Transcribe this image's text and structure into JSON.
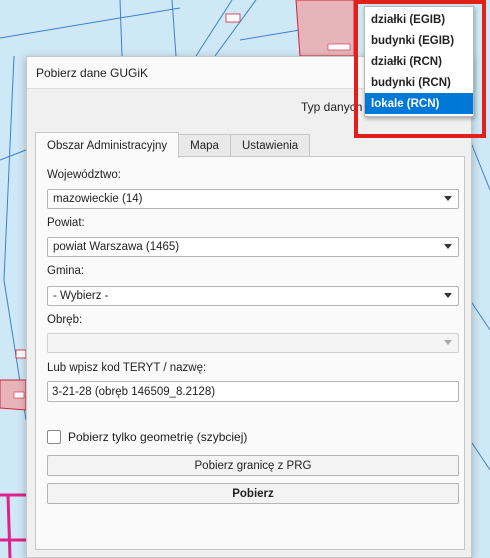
{
  "dialog": {
    "title": "Pobierz dane GUGiK",
    "typ_label": "Typ danych"
  },
  "tabs": [
    {
      "label": "Obszar Administracyjny",
      "active": true
    },
    {
      "label": "Mapa",
      "active": false
    },
    {
      "label": "Ustawienia",
      "active": false
    }
  ],
  "form": {
    "wojewodztwo_label": "Województwo:",
    "wojewodztwo_value": "mazowieckie (14)",
    "powiat_label": "Powiat:",
    "powiat_value": "powiat Warszawa (1465)",
    "gmina_label": "Gmina:",
    "gmina_value": "- Wybierz -",
    "obreb_label": "Obręb:",
    "obreb_value": "",
    "teryt_label": "Lub wpisz kod TERYT / nazwę:",
    "teryt_value": "3-21-28 (obręb 146509_8.2128)",
    "checkbox_label": "Pobierz tylko geometrię (szybciej)",
    "checkbox_checked": false,
    "prg_button": "Pobierz granicę z PRG",
    "pobierz_button": "Pobierz"
  },
  "typ_options": [
    {
      "label": "działki (EGIB)",
      "selected": false
    },
    {
      "label": "budynki (EGIB)",
      "selected": false
    },
    {
      "label": "działki (RCN)",
      "selected": false
    },
    {
      "label": "budynki (RCN)",
      "selected": false
    },
    {
      "label": "lokale (RCN)",
      "selected": true
    }
  ],
  "colors": {
    "highlight": "#e0211b",
    "selection": "#0078d7",
    "map_water": "#cfe8f5",
    "parcel_fill": "#e7b4ba",
    "parcel_line": "#d1223a",
    "boundary": "#e0218a"
  }
}
